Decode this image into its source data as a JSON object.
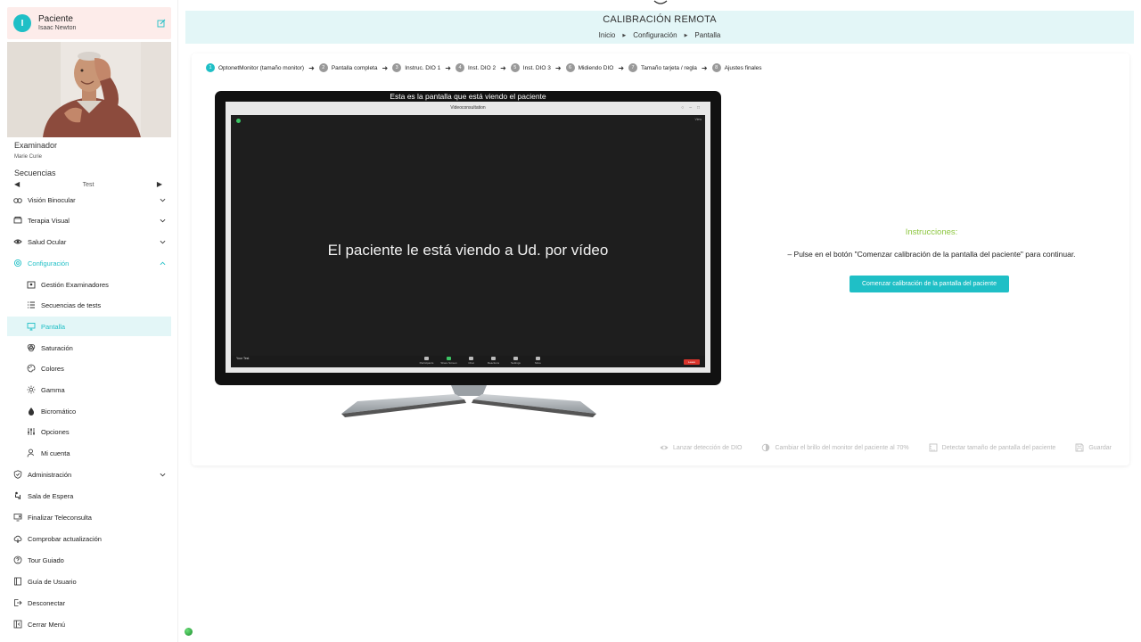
{
  "patient": {
    "label": "Paciente",
    "name": "Isaac Newton",
    "initial": "I"
  },
  "examiner": {
    "label": "Examinador",
    "name": "Marie Curie"
  },
  "sequences": {
    "label": "Secuencias",
    "value": "Test"
  },
  "menu": {
    "items": [
      {
        "label": "Visión Binocular",
        "icon": "binocular-icon",
        "chevron": "down"
      },
      {
        "label": "Terapia Visual",
        "icon": "therapy-icon",
        "chevron": "down"
      },
      {
        "label": "Salud Ocular",
        "icon": "eye-health-icon",
        "chevron": "down"
      },
      {
        "label": "Configuración",
        "icon": "gear-icon",
        "chevron": "up"
      },
      {
        "label": "Gestión Examinadores",
        "icon": "examiners-icon"
      },
      {
        "label": "Secuencias de tests",
        "icon": "list-icon"
      },
      {
        "label": "Pantalla",
        "icon": "monitor-icon"
      },
      {
        "label": "Saturación",
        "icon": "saturation-icon"
      },
      {
        "label": "Colores",
        "icon": "palette-icon"
      },
      {
        "label": "Gamma",
        "icon": "sun-icon"
      },
      {
        "label": "Bicromático",
        "icon": "drop-icon"
      },
      {
        "label": "Opciones",
        "icon": "sliders-icon"
      },
      {
        "label": "Mi cuenta",
        "icon": "user-icon"
      },
      {
        "label": "Administración",
        "icon": "shield-icon",
        "chevron": "down"
      },
      {
        "label": "Sala de Espera",
        "icon": "waiting-room-icon"
      },
      {
        "label": "Finalizar Teleconsulta",
        "icon": "end-call-icon"
      },
      {
        "label": "Comprobar actualización",
        "icon": "cloud-icon"
      },
      {
        "label": "Tour Guiado",
        "icon": "help-icon"
      },
      {
        "label": "Guía de Usuario",
        "icon": "book-icon"
      },
      {
        "label": "Desconectar",
        "icon": "logout-icon"
      },
      {
        "label": "Cerrar Menú",
        "icon": "collapse-icon"
      }
    ]
  },
  "header": {
    "title": "CALIBRACIÓN REMOTA",
    "breadcrumb": [
      "Inicio",
      "Configuración",
      "Pantalla"
    ]
  },
  "steps": [
    {
      "num": "1",
      "label": "OptonetMonitor (tamaño monitor)"
    },
    {
      "num": "2",
      "label": "Pantalla completa"
    },
    {
      "num": "3",
      "label": "Instruc. DIO 1"
    },
    {
      "num": "4",
      "label": "Inst. DIO 2"
    },
    {
      "num": "5",
      "label": "Inst. DIO 3"
    },
    {
      "num": "6",
      "label": "Midiendo DIO"
    },
    {
      "num": "7",
      "label": "Tamaño tarjeta / regla"
    },
    {
      "num": "8",
      "label": "Ajustes finales"
    }
  ],
  "monitor": {
    "caption": "Esta es la pantalla que está viendo el paciente",
    "window_title": "Videoconsultation",
    "message": "El paciente le está viendo a Ud. por vídeo",
    "view_label": "View",
    "self_label": "Your Test",
    "controls": [
      "Participants",
      "Share Screen",
      "Chat",
      "Reactions",
      "Settings",
      "More"
    ],
    "leave_label": "Leave"
  },
  "instructions": {
    "title": "Instrucciones:",
    "text": "– Pulse en el botón \"Comenzar calibración de la pantalla del paciente\" para continuar.",
    "button": "Comenzar calibración de la pantalla del paciente"
  },
  "toolbar": {
    "dio": "Lanzar detección de DIO",
    "brightness": "Cambiar el brillo del monitor del paciente al 70%",
    "detect_size": "Detectar tamaño de pantalla del paciente",
    "save": "Guardar"
  },
  "colors": {
    "accent": "#1fbfc6",
    "instructions_title": "#8cc63f",
    "patient_card": "#fdecea",
    "header_bg": "#e3f6f7"
  }
}
